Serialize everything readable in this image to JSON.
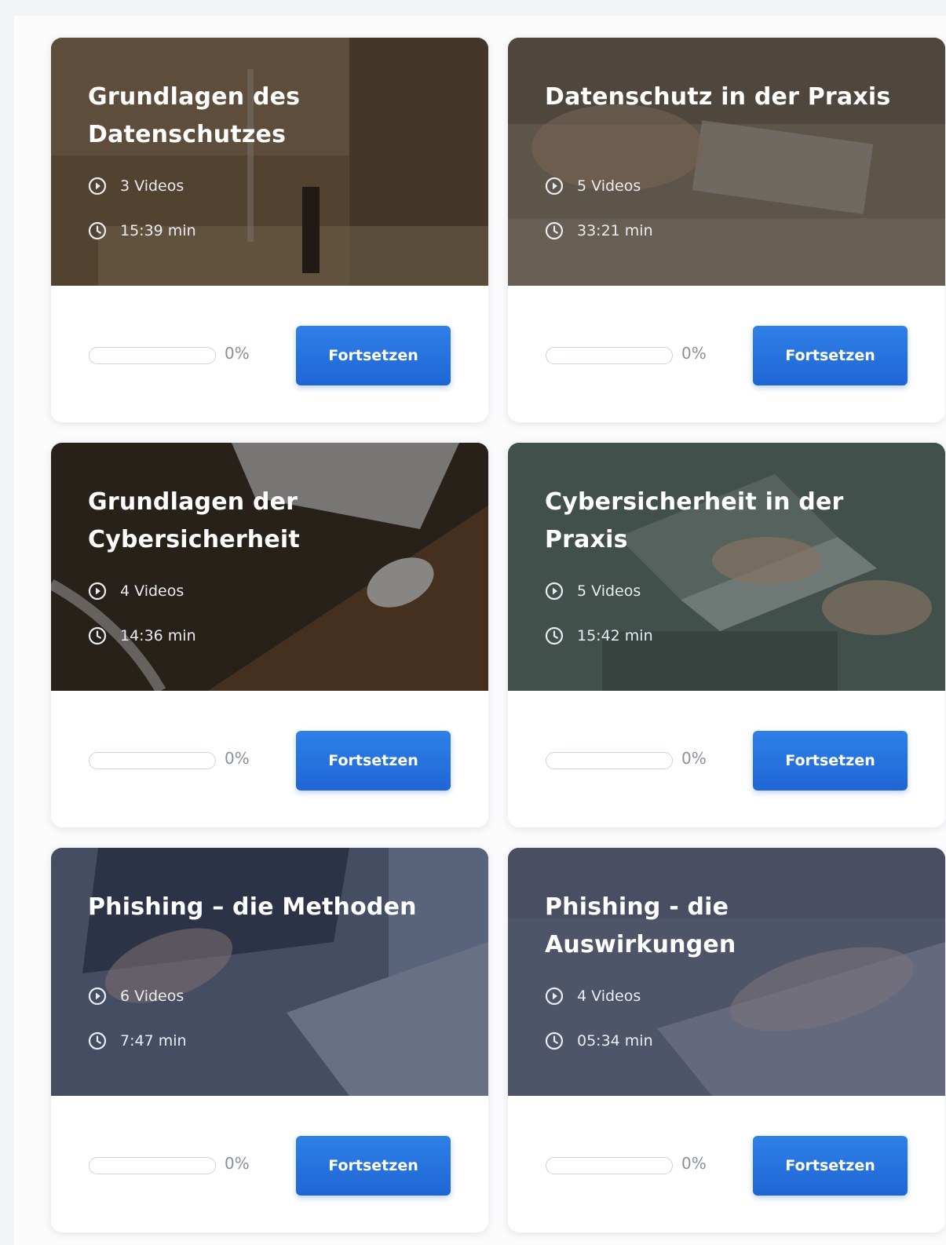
{
  "courses": [
    {
      "title": "Grundlagen des Datenschutzes",
      "videos": "3 Videos",
      "duration": "15:39 min",
      "progress_label": "0%",
      "progress": 0,
      "button_label": "Fortsetzen"
    },
    {
      "title": "Datenschutz in der Praxis",
      "videos": "5 Videos",
      "duration": "33:21 min",
      "progress_label": "0%",
      "progress": 0,
      "button_label": "Fortsetzen"
    },
    {
      "title": "Grundlagen der Cybersicherheit",
      "videos": "4 Videos",
      "duration": "14:36 min",
      "progress_label": "0%",
      "progress": 0,
      "button_label": "Fortsetzen"
    },
    {
      "title": "Cybersicherheit in der Praxis",
      "videos": "5 Videos",
      "duration": "15:42 min",
      "progress_label": "0%",
      "progress": 0,
      "button_label": "Fortsetzen"
    },
    {
      "title": "Phishing – die Methoden",
      "videos": "6 Videos",
      "duration": "7:47 min",
      "progress_label": "0%",
      "progress": 0,
      "button_label": "Fortsetzen"
    },
    {
      "title": "Phishing - die Auswirkungen",
      "videos": "4 Videos",
      "duration": "05:34 min",
      "progress_label": "0%",
      "progress": 0,
      "button_label": "Fortsetzen"
    }
  ],
  "icons": {
    "videos": "play-circle-icon",
    "duration": "clock-icon"
  },
  "colors": {
    "accent": "#1f66d4"
  }
}
